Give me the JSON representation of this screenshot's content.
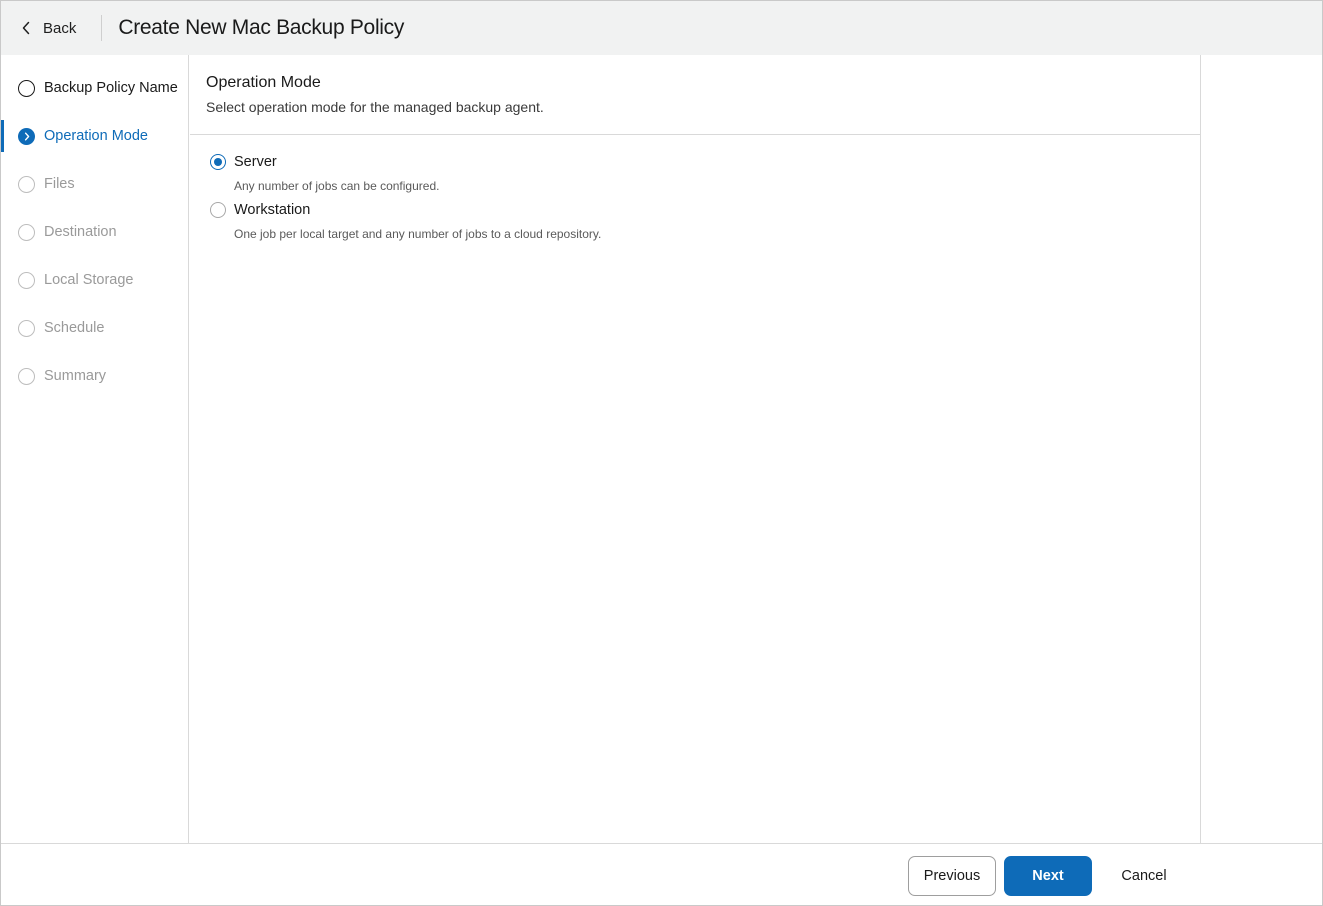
{
  "header": {
    "back_label": "Back",
    "title": "Create New Mac Backup Policy"
  },
  "steps": [
    {
      "label": "Backup Policy Name",
      "state": "done"
    },
    {
      "label": "Operation Mode",
      "state": "active"
    },
    {
      "label": "Files",
      "state": "pending"
    },
    {
      "label": "Destination",
      "state": "pending"
    },
    {
      "label": "Local Storage",
      "state": "pending"
    },
    {
      "label": "Schedule",
      "state": "pending"
    },
    {
      "label": "Summary",
      "state": "pending"
    }
  ],
  "section": {
    "title": "Operation Mode",
    "subtitle": "Select operation mode for the managed backup agent."
  },
  "options": [
    {
      "label": "Server",
      "description": "Any number of jobs can be configured.",
      "selected": true
    },
    {
      "label": "Workstation",
      "description": "One job per local target and any number of jobs to a cloud repository.",
      "selected": false
    }
  ],
  "footer": {
    "previous_label": "Previous",
    "next_label": "Next",
    "cancel_label": "Cancel"
  },
  "colors": {
    "accent": "#0e6bb8",
    "header_bg": "#f1f2f2",
    "pending_text": "#9a9a9a"
  },
  "icons": {
    "back": "chevron-left-icon",
    "active_step": "chevron-right-icon"
  }
}
